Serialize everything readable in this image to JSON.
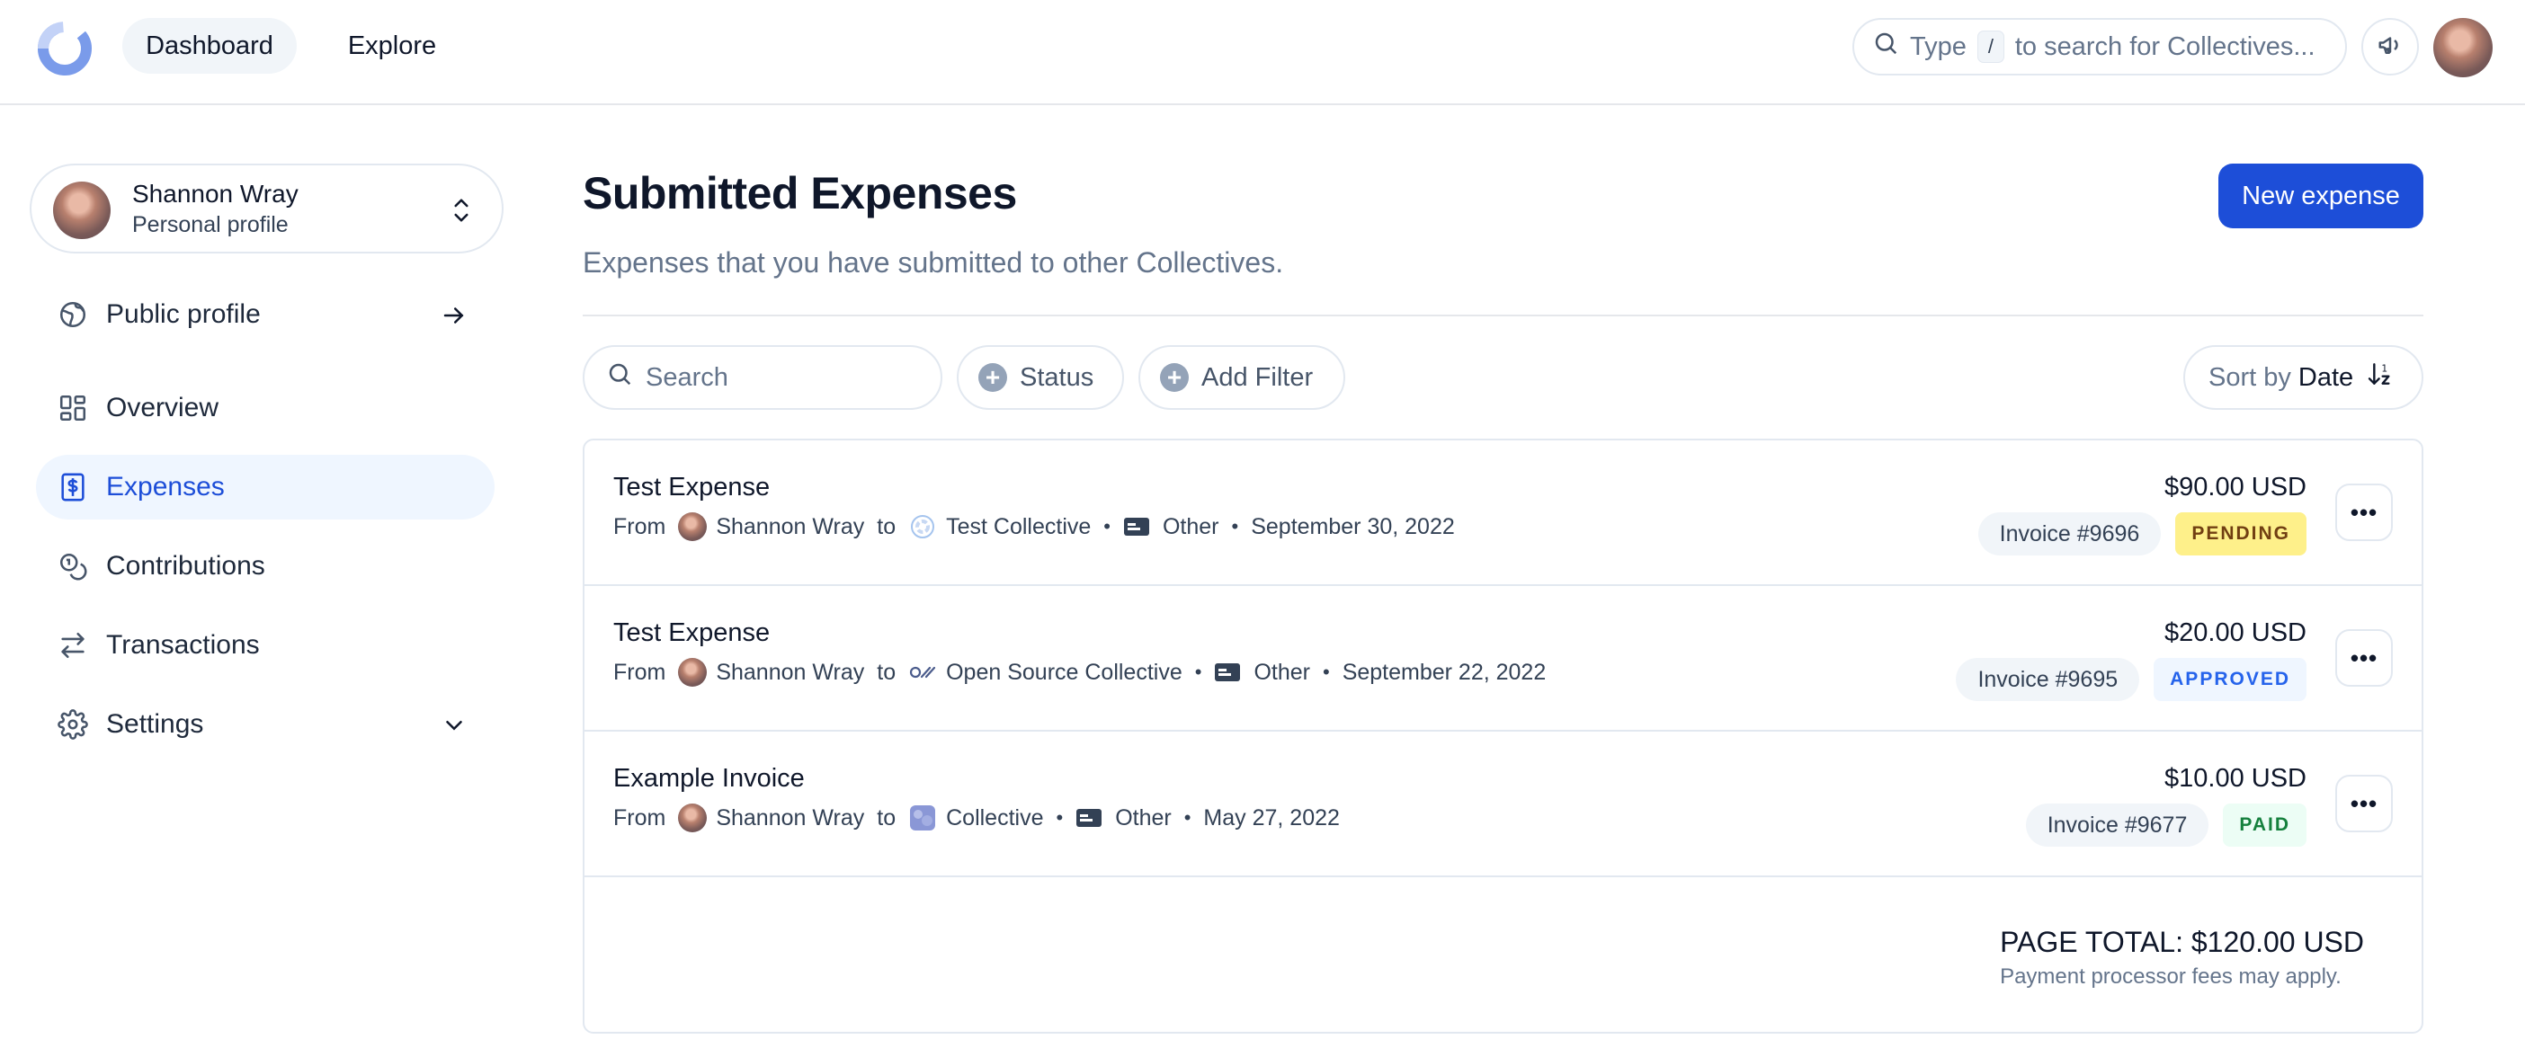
{
  "topbar": {
    "nav": [
      {
        "label": "Dashboard",
        "active": true
      },
      {
        "label": "Explore",
        "active": false
      }
    ],
    "search": {
      "prefix": "Type",
      "key": "/",
      "suffix": "to search for Collectives..."
    },
    "icons": [
      "logo-icon",
      "megaphone-icon",
      "avatar"
    ]
  },
  "sidebar": {
    "profile": {
      "name": "Shannon Wray",
      "subtitle": "Personal profile"
    },
    "items": [
      {
        "label": "Public profile",
        "icon": "globe-icon",
        "trail": "arrow-right-icon"
      },
      {
        "label": "Overview",
        "icon": "dashboard-grid-icon"
      },
      {
        "label": "Expenses",
        "icon": "receipt-dollar-icon",
        "active": true
      },
      {
        "label": "Contributions",
        "icon": "coins-icon"
      },
      {
        "label": "Transactions",
        "icon": "arrows-swap-icon"
      },
      {
        "label": "Settings",
        "icon": "gear-icon",
        "trail": "chevron-down-icon"
      }
    ]
  },
  "main": {
    "title": "Submitted Expenses",
    "subtitle": "Expenses that you have submitted to other Collectives.",
    "new_expense_label": "New expense",
    "filters": {
      "search_placeholder": "Search",
      "status_label": "Status",
      "add_filter_label": "Add Filter",
      "sort_prefix": "Sort by",
      "sort_value": "Date"
    },
    "expenses": [
      {
        "title": "Test Expense",
        "from_label": "From",
        "from_name": "Shannon Wray",
        "to_label": "to",
        "to_name": "Test Collective",
        "type": "Other",
        "date": "September 30, 2022",
        "amount": "$90.00 USD",
        "invoice": "Invoice #9696",
        "status": "PENDING"
      },
      {
        "title": "Test Expense",
        "from_label": "From",
        "from_name": "Shannon Wray",
        "to_label": "to",
        "to_name": "Open Source Collective",
        "type": "Other",
        "date": "September 22, 2022",
        "amount": "$20.00 USD",
        "invoice": "Invoice #9695",
        "status": "APPROVED"
      },
      {
        "title": "Example Invoice",
        "from_label": "From",
        "from_name": "Shannon Wray",
        "to_label": "to",
        "to_name": "Collective",
        "type": "Other",
        "date": "May 27, 2022",
        "amount": "$10.00 USD",
        "invoice": "Invoice #9677",
        "status": "PAID"
      }
    ],
    "page_total": "PAGE TOTAL: $120.00 USD",
    "fees_note": "Payment processor fees may apply."
  },
  "colors": {
    "accent": "#1d4ed8",
    "pending_bg": "#fef08a",
    "approved_bg": "#eff6ff",
    "paid_bg": "#ecfdf5"
  }
}
